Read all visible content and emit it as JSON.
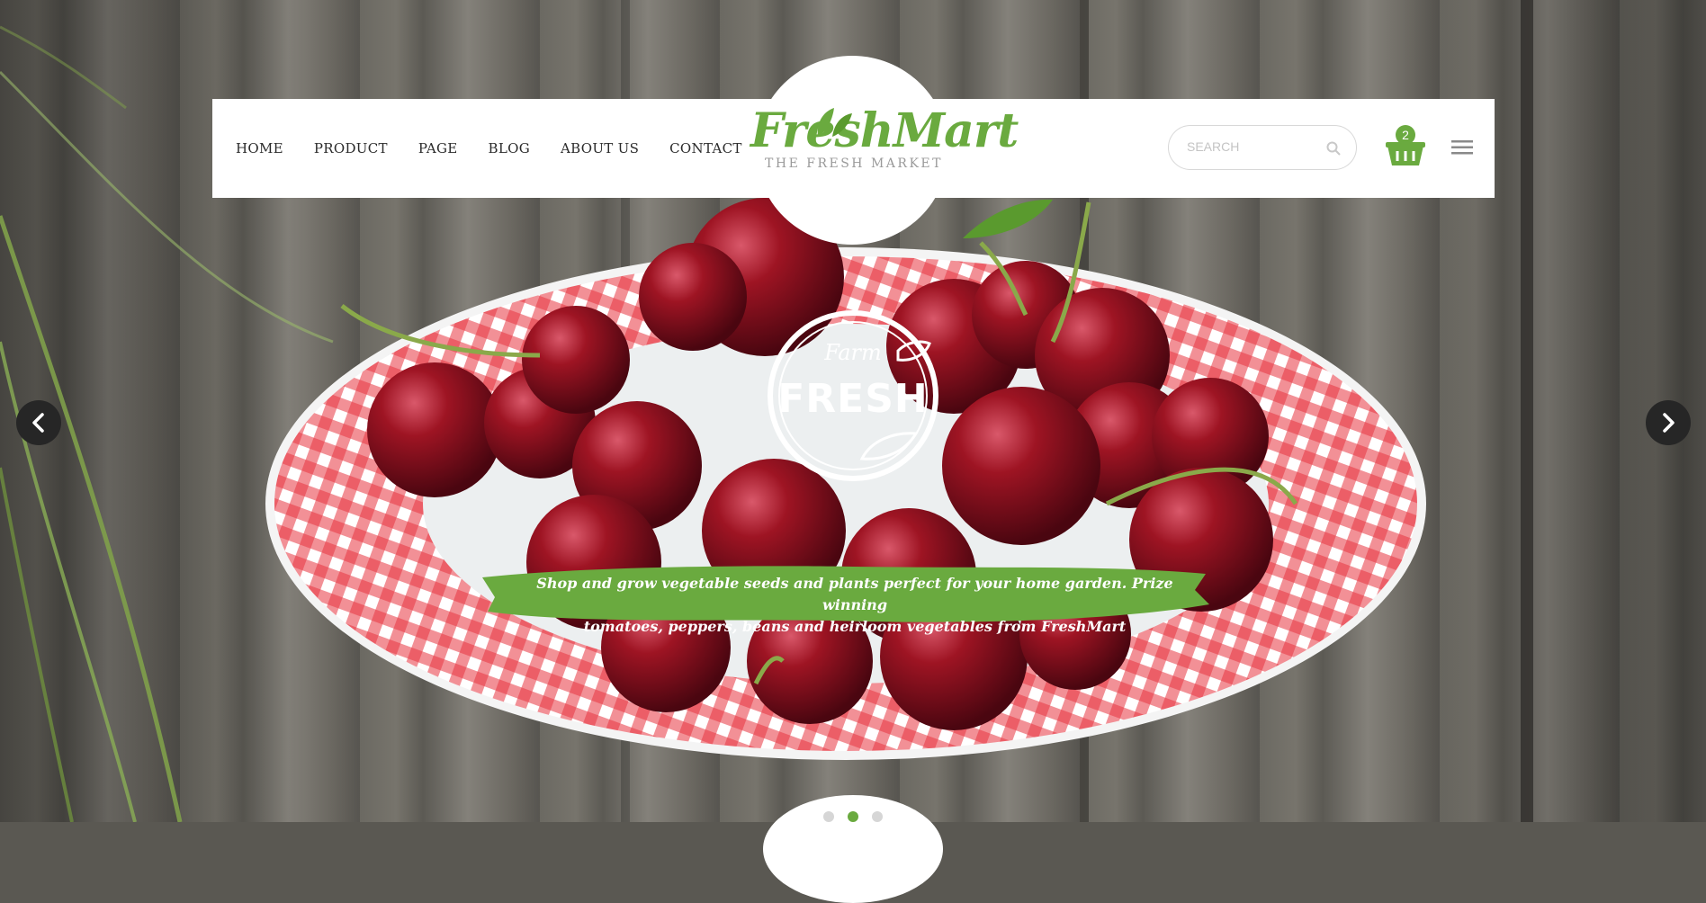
{
  "nav": {
    "items": [
      "HOME",
      "PRODUCT",
      "PAGE",
      "BLOG",
      "ABOUT US",
      "CONTACT"
    ]
  },
  "logo": {
    "name": "FreshMart",
    "tagline": "THE FRESH MARKET"
  },
  "search": {
    "placeholder": "SEARCH",
    "icon": "search-icon"
  },
  "cart": {
    "count": "2",
    "icon": "basket-icon"
  },
  "menu": {
    "icon": "hamburger-menu-icon"
  },
  "slider": {
    "prev_icon": "chevron-left-icon",
    "next_icon": "chevron-right-icon",
    "badge_top": "Farm",
    "badge_main": "FRESH",
    "caption_line1": "Shop and grow vegetable seeds and plants perfect for your home garden. Prize winning",
    "caption_line2": "tomatoes, peppers, beans and heirloom vegetables from FreshMart",
    "active_slide": 2,
    "slide_count": 3
  },
  "colors": {
    "accent": "#6aaa3f",
    "text": "#2b2b2b",
    "arrow_bg": "#262626"
  }
}
